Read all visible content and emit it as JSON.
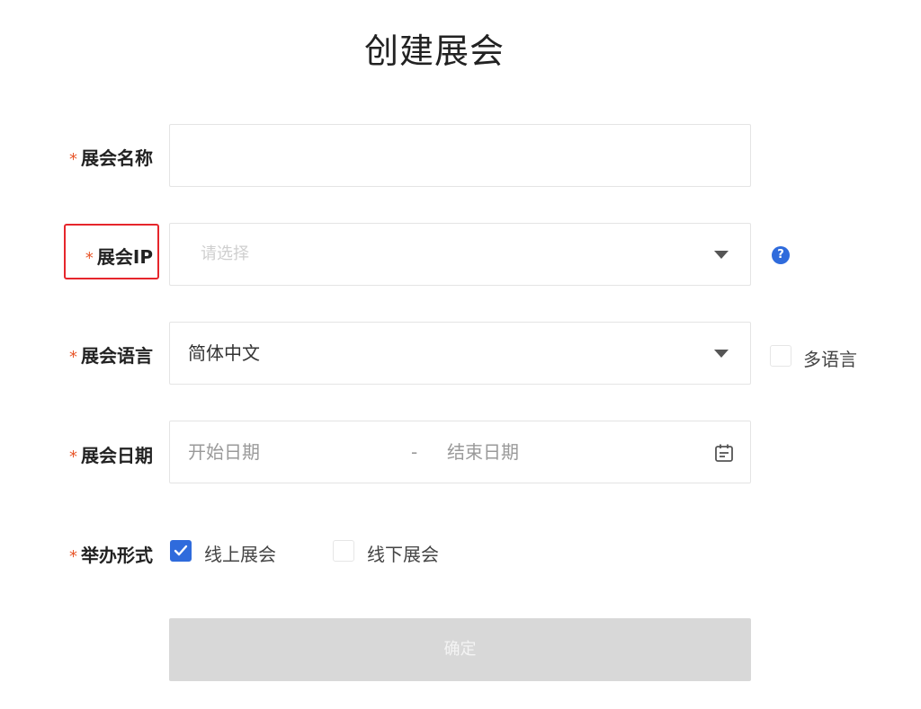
{
  "page": {
    "title": "创建展会"
  },
  "form": {
    "required_mark": "*",
    "name": {
      "label": "展会名称",
      "value": ""
    },
    "ip": {
      "label": "展会IP",
      "placeholder": "请选择",
      "help_icon": "question-circle-icon",
      "highlighted": true
    },
    "language": {
      "label": "展会语言",
      "value": "简体中文",
      "multi_language_label": "多语言",
      "multi_language_checked": false
    },
    "date": {
      "label": "展会日期",
      "start_placeholder": "开始日期",
      "separator": "-",
      "end_placeholder": "结束日期",
      "icon": "calendar-icon"
    },
    "format": {
      "label": "举办形式",
      "options": [
        {
          "label": "线上展会",
          "checked": true
        },
        {
          "label": "线下展会",
          "checked": false
        }
      ]
    },
    "submit_label": "确定"
  },
  "colors": {
    "accent": "#2f6bdc",
    "required_star": "#e8562a",
    "highlight_border": "#e6262c",
    "submit_disabled_bg": "#d8d8d8"
  }
}
